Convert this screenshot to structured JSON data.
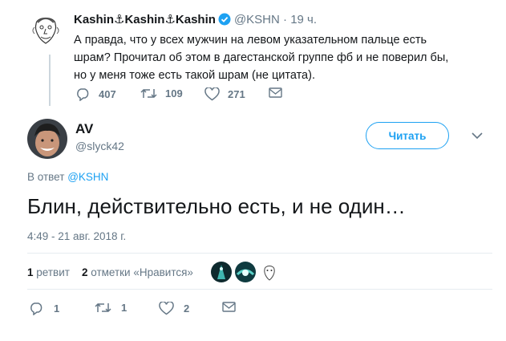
{
  "parent_tweet": {
    "name": "Kashin⚓Kashin⚓Kashin",
    "handle": "@KSHN",
    "time": "19 ч.",
    "text": "А правда, что у всех мужчин на левом указательном пальце есть шрам? Прочитал об этом в дагестанской группе фб и не поверил бы, но у меня тоже есть такой шрам (не цитата).",
    "replies": "407",
    "retweets": "109",
    "likes": "271"
  },
  "tweet": {
    "name": "AV",
    "handle": "@slyck42",
    "follow_label": "Читать",
    "reply_prefix": "В ответ",
    "reply_to": "@KSHN",
    "text": "Блин, действительно есть, и не один…",
    "timestamp": "4:49 - 21 авг. 2018 г.",
    "retweet_count": "1",
    "retweet_label": "ретвит",
    "like_count": "2",
    "like_label": "отметки «Нравится»",
    "replies": "1",
    "retweets": "1",
    "likes": "2"
  },
  "colors": {
    "accent": "#1da1f2",
    "muted": "#657786",
    "divider": "#e6ecf0"
  }
}
